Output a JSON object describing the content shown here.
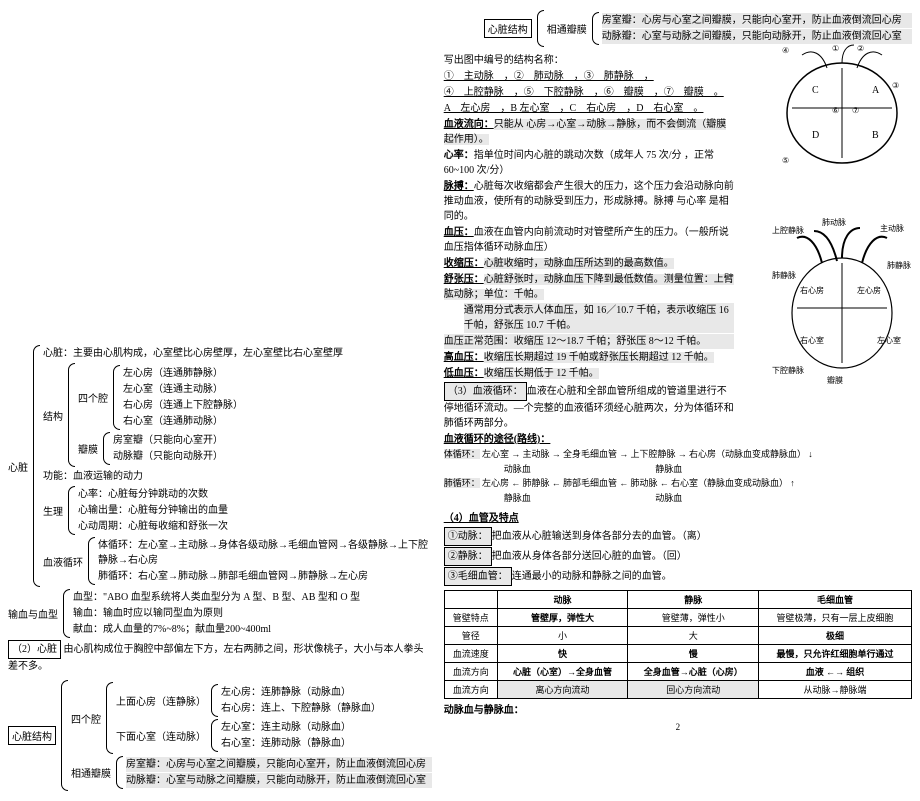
{
  "left": {
    "heart_intro": "心脏：主要由心肌构成，心室壁比心房壁厚，左心室壁比右心室壁厚",
    "structure_label": "结构",
    "chambers_label": "四个腔",
    "chambers": [
      "左心房（连通肺静脉）",
      "左心室（连通主动脉）",
      "右心房（连通上下腔静脉）",
      "右心室（连通肺动脉）"
    ],
    "valves_label": "瓣膜",
    "valves": [
      "房室瓣（只能向心室开）",
      "动脉瓣（只能向动脉开）"
    ],
    "heart_label": "心脏",
    "function_label": "功能：",
    "function": "血液运输的动力",
    "phys_label": "生理",
    "phys": [
      "心率：心脏每分钟跳动的次数",
      "心输出量：心脏每分钟输出的血量",
      "心动周期：心脏每收缩和舒张一次"
    ],
    "circ_label": "血液循环",
    "circ1": "体循环：左心室→主动脉→身体各级动脉→毛细血管网→各级静脉→上下腔静脉→右心房",
    "circ2": "肺循环：右心室→肺动脉→肺部毛细血管网→肺静脉→左心房",
    "blood_trans_label": "输血与血型",
    "bt1": "血型：\"ABO 血型系统将人类血型分为 A 型、B 型、AB 型和 O 型",
    "bt2": "输血：输血时应以输同型血为原则",
    "bt3": "献血：成人血量的7%~8%；献血量200~400ml",
    "section2_label": "（2）心脏",
    "section2_text": "由心肌构成位于胸腔中部偏左下方，左右两肺之间，形状像桃子，大小与本人拳头差不多。",
    "struct_box": "心脏结构",
    "s2_chambers_label": "四个腔",
    "s2_upper": "上面心房（连静脉）",
    "s2_lower": "下面心室（连动脉）",
    "s2_chambers": [
      "左心房：连肺静脉（动脉血）",
      "右心房：连上、下腔静脉（静脉血）",
      "左心室：连主动脉（动脉血）",
      "右心室：连肺动脉（静脉血）"
    ],
    "s2_valves_label": "相通瓣膜",
    "s2_valves": [
      "房室瓣：心房与心室之间瓣膜，只能向心室开，防止血液倒流回心房",
      "动脉瓣：心室与动脉之间瓣膜，只能向动脉开，防止血液倒流回心室"
    ]
  },
  "right": {
    "top_box": "心脏结构",
    "top_valves_label": "相通瓣膜",
    "top_valves": [
      "房室瓣：心房与心室之间瓣膜，只能向心室开，防止血液倒流回心房",
      "动脉瓣：心室与动脉之间瓣膜，只能向动脉开，防止血液倒流回心室"
    ],
    "fig_intro": "写出图中编号的结构名称：",
    "fig_labels1": "①　主动脉　，②　肺动脉　，③　肺静脉　，",
    "fig_labels2": "④　上腔静脉　，⑤　下腔静脉　，⑥　瓣膜　，⑦　瓣膜　。",
    "fig_abcd": "A　左心房　，B 左心室　，C　右心房　，D　右心室　。",
    "flow_dir_label": "血液流向：",
    "flow_dir": "只能从 心房→心室→动脉→静脉，而不会倒流（瓣膜起作用）。",
    "hr_label": "心率：",
    "hr": "指单位时间内心脏的跳动次数（成年人 75 次/分 ，正常 60~100 次/分）",
    "pulse_label": "脉搏：",
    "pulse": "心脏每次收缩都会产生很大的压力，这个压力会沿动脉向前推动血液，使所有的动脉受到压力，形成脉搏。脉搏 与心率 是相同的。",
    "bp_label": "血压：",
    "bp": "血液在血管内向前流动时对管壁所产生的压力。（一般所说血压指体循环动脉血压）",
    "sys_label": "收缩压：",
    "sys": "心脏收缩时，动脉血压所达到的最高数值。",
    "dia_label": "舒张压：",
    "dia": "心脏舒张时，动脉血压下降到最低数值。测量位置：上臂肱动脉；单位：千帕。",
    "bp_ex": "通常用分式表示人体血压，如 16／10.7 千帕，表示收缩压 16 千帕，舒张压 10.7 千帕。",
    "bp_normal": "血压正常范围：收缩压 12～18.7 千帕；舒张压 8～12 千帕。",
    "bp_high_label": "高血压：",
    "bp_high": "收缩压长期超过 19 千帕或舒张压长期超过 12 千帕。",
    "bp_low_label": "低血压：",
    "bp_low": "收缩压长期低于 12 千帕。",
    "circ3_label": "（3）血液循环：",
    "circ3": "血液在心脏和全部血管所组成的管道里进行不停地循环流动。—个完整的血液循环须经心脏两次，分为体循环和肺循环两部分。",
    "path_label": "血液循环的途径(路线)：",
    "sys_circ_label": "体循环：",
    "sys_circ": "左心室 → 主动脉 → 全身毛细血管 → 上下腔静脉 → 右心房（动脉血变成静脉血）",
    "sys_circ_b1": "动脉血",
    "sys_circ_b2": "静脉血",
    "pul_circ_label": "肺循环：",
    "pul_circ": "左心房 ← 肺静脉 ← 肺部毛细血管 ← 肺动脉 ← 右心室（静脉血变成动脉血）",
    "pul_circ_b1": "静脉血",
    "pul_circ_b2": "动脉血",
    "vessel_label": "（4）血管及特点",
    "v1_label": "①动脉：",
    "v1": "把血液从心脏输送到身体各部分去的血管。（离）",
    "v2_label": "②静脉：",
    "v2": "把血液从身体各部分送回心脏的血管。（回）",
    "v3_label": "③毛细血管：",
    "v3": "连通最小的动脉和静脉之间的血管。",
    "table": {
      "headers": [
        "",
        "动脉",
        "静脉",
        "毛细血管"
      ],
      "rows": [
        [
          "管壁特点",
          "管壁厚，弹性大",
          "管壁薄，弹性小",
          "管壁极薄，只有一层上皮细胞"
        ],
        [
          "管径",
          "小",
          "大",
          "极细"
        ],
        [
          "血流速度",
          "快",
          "慢",
          "最慢，只允许红细胞单行通过"
        ],
        [
          "血流方向",
          "心脏（心室）→全身血管",
          "全身血管→心脏（心房）",
          "血液 ←→ 组织"
        ],
        [
          "血流方向",
          "离心方向流动",
          "回心方向流动",
          "从动脉→静脉端"
        ]
      ]
    },
    "footer": "动脉血与静脉血：",
    "diagram2_labels": [
      "上腔静脉",
      "肺动脉",
      "主动脉",
      "肺静脉",
      "右心房",
      "左心房",
      "下腔静脉",
      "右心室",
      "左心室",
      "瓣膜",
      "肺静脉"
    ]
  },
  "page_num": "2"
}
